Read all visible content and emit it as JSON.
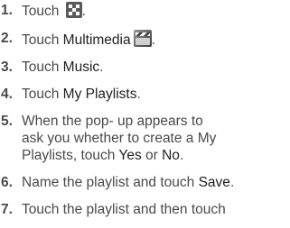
{
  "steps": [
    {
      "num": "1.",
      "pre": "Touch ",
      "icon": "grid-icon",
      "post": "."
    },
    {
      "num": "2.",
      "pre": "Touch ",
      "kw": "Multimedia",
      "icon": "clapperboard-icon",
      "post": "."
    },
    {
      "num": "3.",
      "pre": "Touch ",
      "kw": "Music",
      "post": "."
    },
    {
      "num": "4.",
      "pre": "Touch ",
      "kw": "My Playlists",
      "post": "."
    },
    {
      "num": "5.",
      "line1": "When the pop- up appears to",
      "line2": "ask you whether to create a My",
      "line3_pre": "Playlists, touch ",
      "kw_yes": "Yes",
      "mid": " or ",
      "kw_no": "No",
      "post": "."
    },
    {
      "num": "6.",
      "pre": "Name the playlist and touch ",
      "kw": "Save",
      "post": "."
    },
    {
      "num": "7.",
      "pre": "Touch the playlist and then touch"
    }
  ]
}
